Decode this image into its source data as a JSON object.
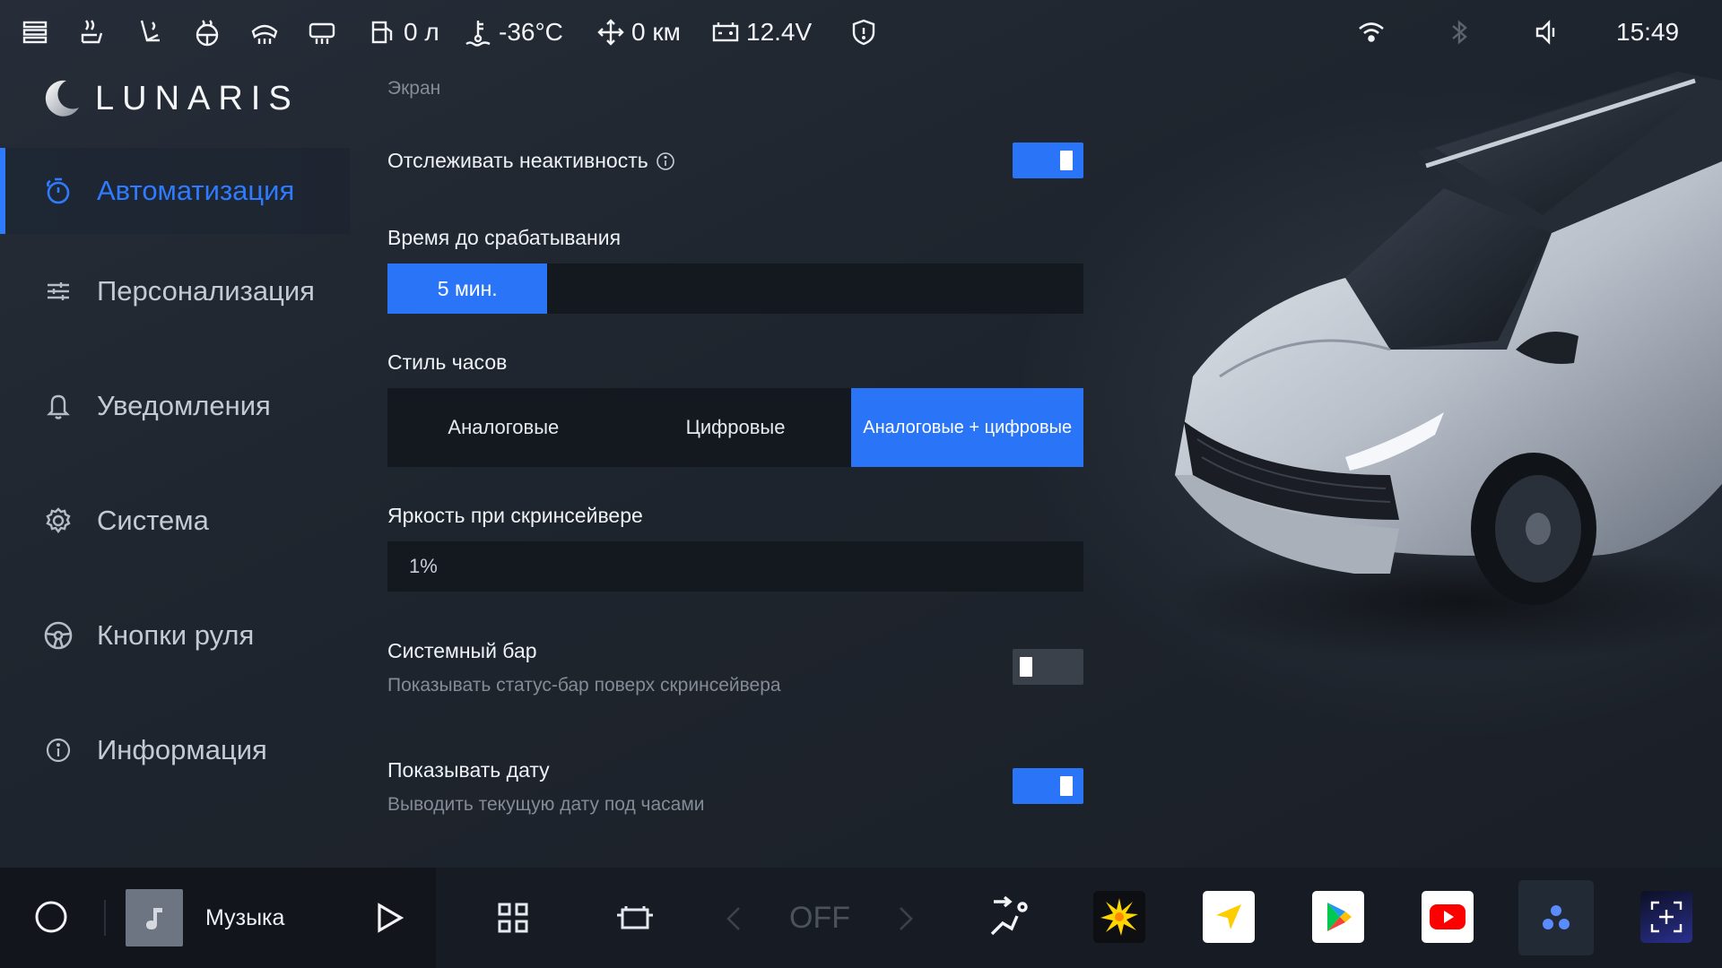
{
  "status_bar": {
    "fuel": "0 л",
    "temperature": "-36°C",
    "range": "0 км",
    "voltage": "12.4V",
    "time": "15:49"
  },
  "brand": {
    "name": "LUNARIS"
  },
  "sidebar": {
    "items": [
      {
        "label": "Автоматизация",
        "icon": "timer-icon",
        "active": true
      },
      {
        "label": "Персонализация",
        "icon": "sliders-icon",
        "active": false
      },
      {
        "label": "Уведомления",
        "icon": "bell-icon",
        "active": false
      },
      {
        "label": "Система",
        "icon": "gear-icon",
        "active": false
      },
      {
        "label": "Кнопки руля",
        "icon": "steering-wheel-icon",
        "active": false
      },
      {
        "label": "Информация",
        "icon": "info-icon",
        "active": false
      }
    ]
  },
  "settings": {
    "section_title": "Экран",
    "track_inactivity": {
      "label": "Отслеживать неактивность",
      "enabled": true
    },
    "trigger_time": {
      "label": "Время до срабатывания",
      "value": "5 мин.",
      "fill_fraction": 0.23
    },
    "clock_style": {
      "label": "Стиль часов",
      "options": [
        "Аналоговые",
        "Цифровые",
        "Аналоговые + цифровые"
      ],
      "selected_index": 2
    },
    "screensaver_brightness": {
      "label": "Яркость при скринсейвере",
      "value": "1%"
    },
    "system_bar": {
      "label": "Системный бар",
      "description": "Показывать статус-бар поверх скринсейвера",
      "enabled": false
    },
    "show_date": {
      "label": "Показывать дату",
      "description": "Выводить текущую дату под часами",
      "enabled": true
    }
  },
  "dock": {
    "media_label": "Музыка",
    "climate_value": "OFF",
    "apps": [
      "yandex-music-icon",
      "navigator-icon",
      "google-play-icon",
      "youtube-icon",
      "launcher-icon",
      "screenshot-icon"
    ]
  },
  "colors": {
    "accent": "#2a74f8",
    "background": "#1c222c",
    "panel": "#141920"
  }
}
